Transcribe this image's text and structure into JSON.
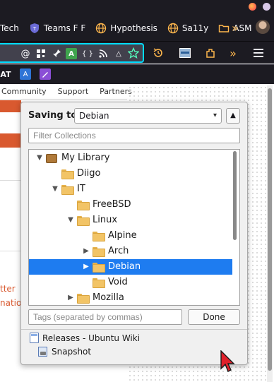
{
  "browser": {
    "bookmarks": [
      {
        "label": "Tech",
        "icon": "tech-icon"
      },
      {
        "label": "Teams F F",
        "icon": "teams-shield-icon"
      },
      {
        "label": "Hypothesis",
        "icon": "globe-icon"
      },
      {
        "label": "Sa11y",
        "icon": "globe-icon"
      },
      {
        "label": "ASM",
        "icon": "folder-icon"
      }
    ],
    "toolbar_icons": [
      "at-symbol-icon",
      "qr-icon",
      "pin-icon",
      "translate-icon",
      "code-icon",
      "rss-icon",
      "triangle-icon",
      "star-icon",
      "history-icon",
      "layout-icon",
      "extension-icon",
      "overflow-icon",
      "menu-icon"
    ],
    "accent_color": "#00ddff"
  },
  "page": {
    "nav_items": [
      "Community",
      "Support",
      "Partners"
    ],
    "fragments": [
      "tter",
      "nation"
    ],
    "accent_color": "#d9592f"
  },
  "zotero": {
    "saving_to_label": "Saving to",
    "selected_collection": "Debian",
    "filter_placeholder": "Filter Collections",
    "tree": [
      {
        "label": "My Library",
        "icon": "library-icon",
        "twisty": "down",
        "depth": 0
      },
      {
        "label": "Diigo",
        "icon": "folder-icon",
        "twisty": "none",
        "depth": 1
      },
      {
        "label": "IT",
        "icon": "folder-icon",
        "twisty": "down",
        "depth": 1
      },
      {
        "label": "FreeBSD",
        "icon": "folder-icon",
        "twisty": "none",
        "depth": 2
      },
      {
        "label": "Linux",
        "icon": "folder-icon",
        "twisty": "down",
        "depth": 2
      },
      {
        "label": "Alpine",
        "icon": "folder-icon",
        "twisty": "none",
        "depth": 3
      },
      {
        "label": "Arch",
        "icon": "folder-icon",
        "twisty": "right",
        "depth": 3
      },
      {
        "label": "Debian",
        "icon": "folder-icon",
        "twisty": "right",
        "depth": 3,
        "selected": true
      },
      {
        "label": "Void",
        "icon": "folder-icon",
        "twisty": "none",
        "depth": 3
      },
      {
        "label": "Mozilla",
        "icon": "folder-icon",
        "twisty": "right",
        "depth": 2
      }
    ],
    "tags_placeholder": "Tags (separated by commas)",
    "done_label": "Done",
    "items": [
      {
        "label": "Releases - Ubuntu Wiki",
        "icon": "webpage-icon"
      },
      {
        "label": "Snapshot",
        "icon": "snapshot-icon"
      }
    ],
    "selection_color": "#1e7cf0"
  }
}
